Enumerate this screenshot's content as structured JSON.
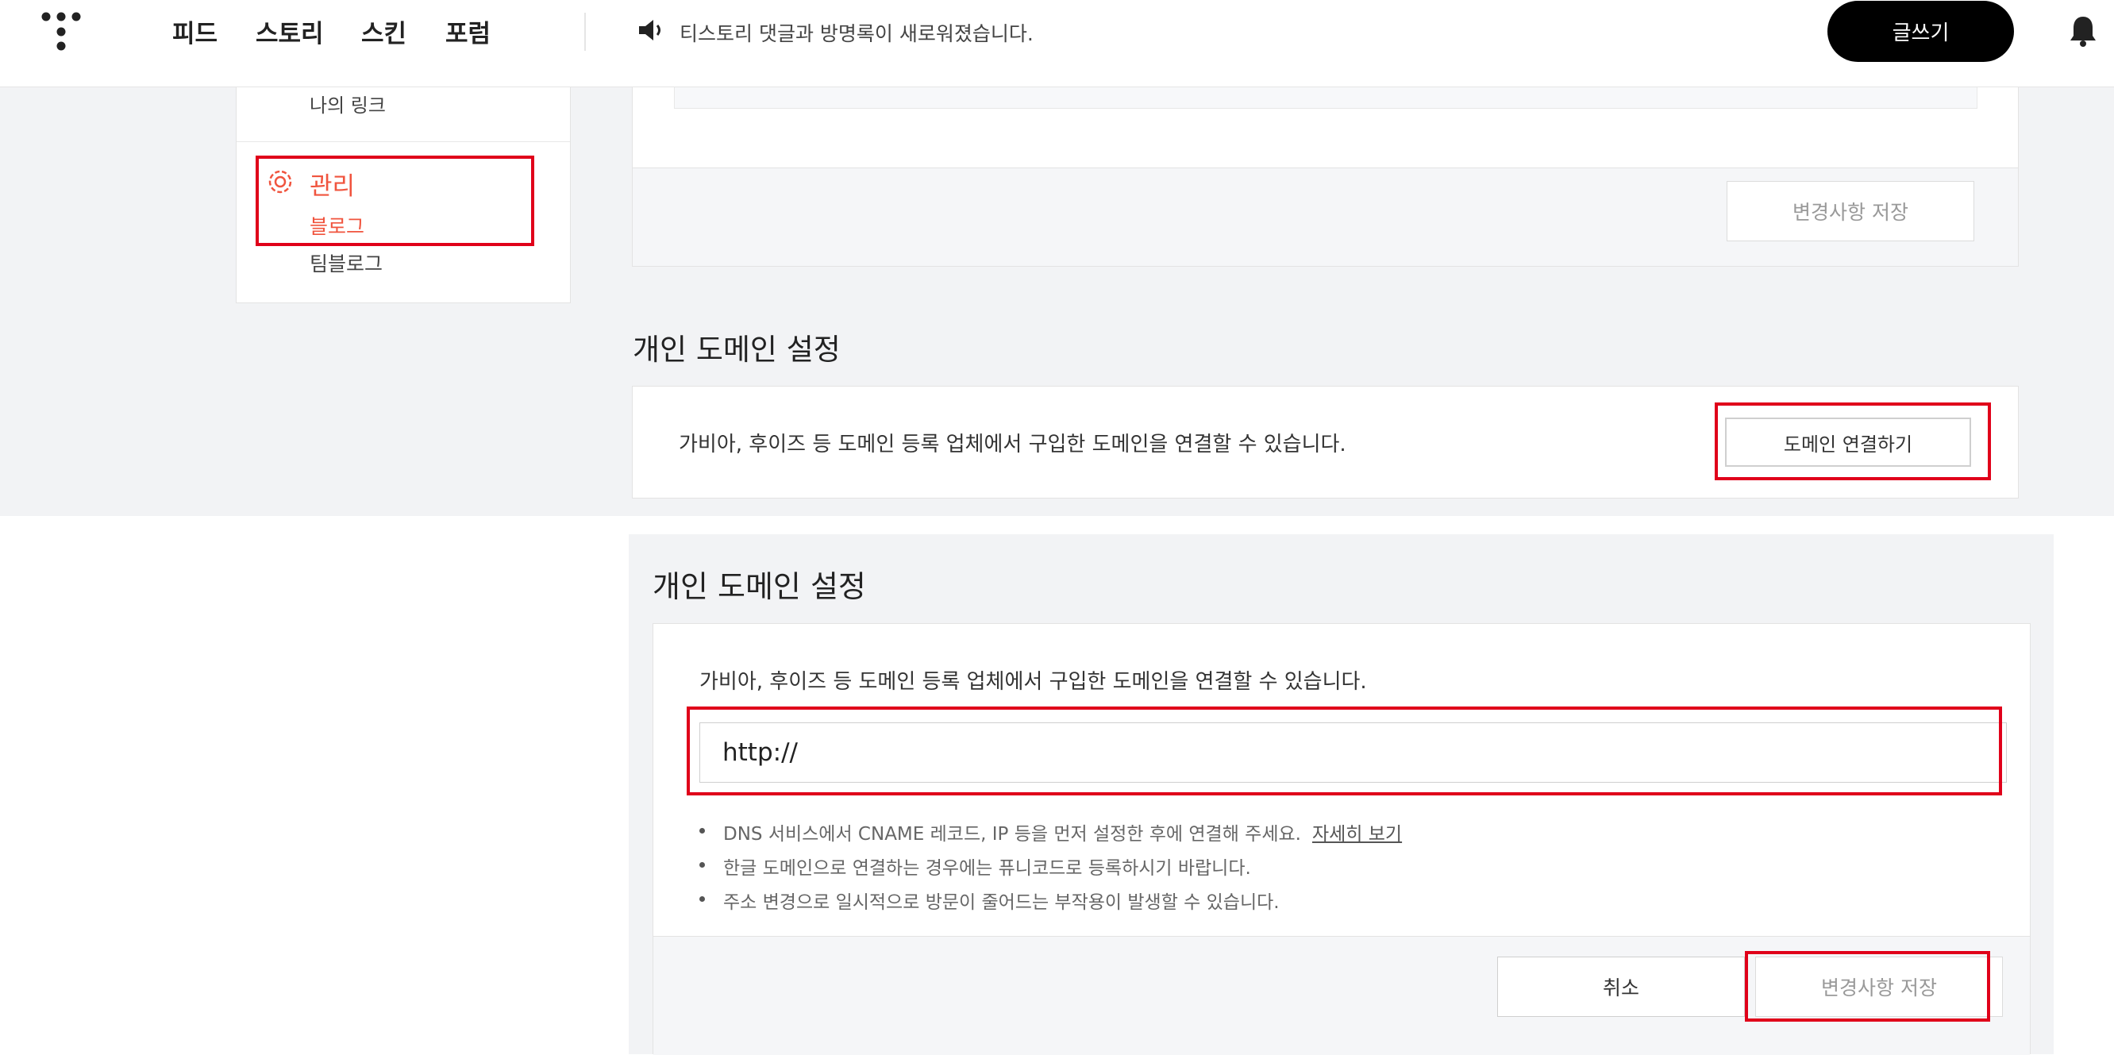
{
  "header": {
    "nav": [
      "피드",
      "스토리",
      "스킨",
      "포럼"
    ],
    "notice": "티스토리 댓글과 방명록이 새로워졌습니다.",
    "write_label": "글쓰기",
    "icons": [
      "tistory-logo-icon",
      "speaker-icon",
      "bell-icon"
    ]
  },
  "sidebar": {
    "my_link": "나의 링크",
    "manage_label": "관리",
    "manage_icon": "gear-icon",
    "items": [
      {
        "label": "블로그",
        "active": true
      },
      {
        "label": "팀블로그",
        "active": false
      }
    ]
  },
  "upper_card": {
    "save_label": "변경사항 저장"
  },
  "domain_section_top": {
    "title": "개인 도메인 설정",
    "description": "가비아, 후이즈 등 도메인 등록 업체에서 구입한 도메인을 연결할 수 있습니다.",
    "connect_label": "도메인 연결하기"
  },
  "domain_section_bottom": {
    "title": "개인 도메인 설정",
    "description": "가비아, 후이즈 등 도메인 등록 업체에서 구입한 도메인을 연결할 수 있습니다.",
    "input_value": "http://",
    "notes": [
      "DNS 서비스에서 CNAME 레코드, IP 등을 먼저 설정한 후에 연결해 주세요.",
      "한글 도메인으로 연결하는 경우에는 퓨니코드로 등록하시기 바랍니다.",
      "주소 변경으로 일시적으로 방문이 줄어드는 부작용이 발생할 수 있습니다."
    ],
    "details_link": "자세히 보기",
    "cancel_label": "취소",
    "save_label": "변경사항 저장"
  },
  "colors": {
    "accent": "#f0543e",
    "highlight": "#e0001a",
    "panel_bg": "#f2f3f5"
  }
}
